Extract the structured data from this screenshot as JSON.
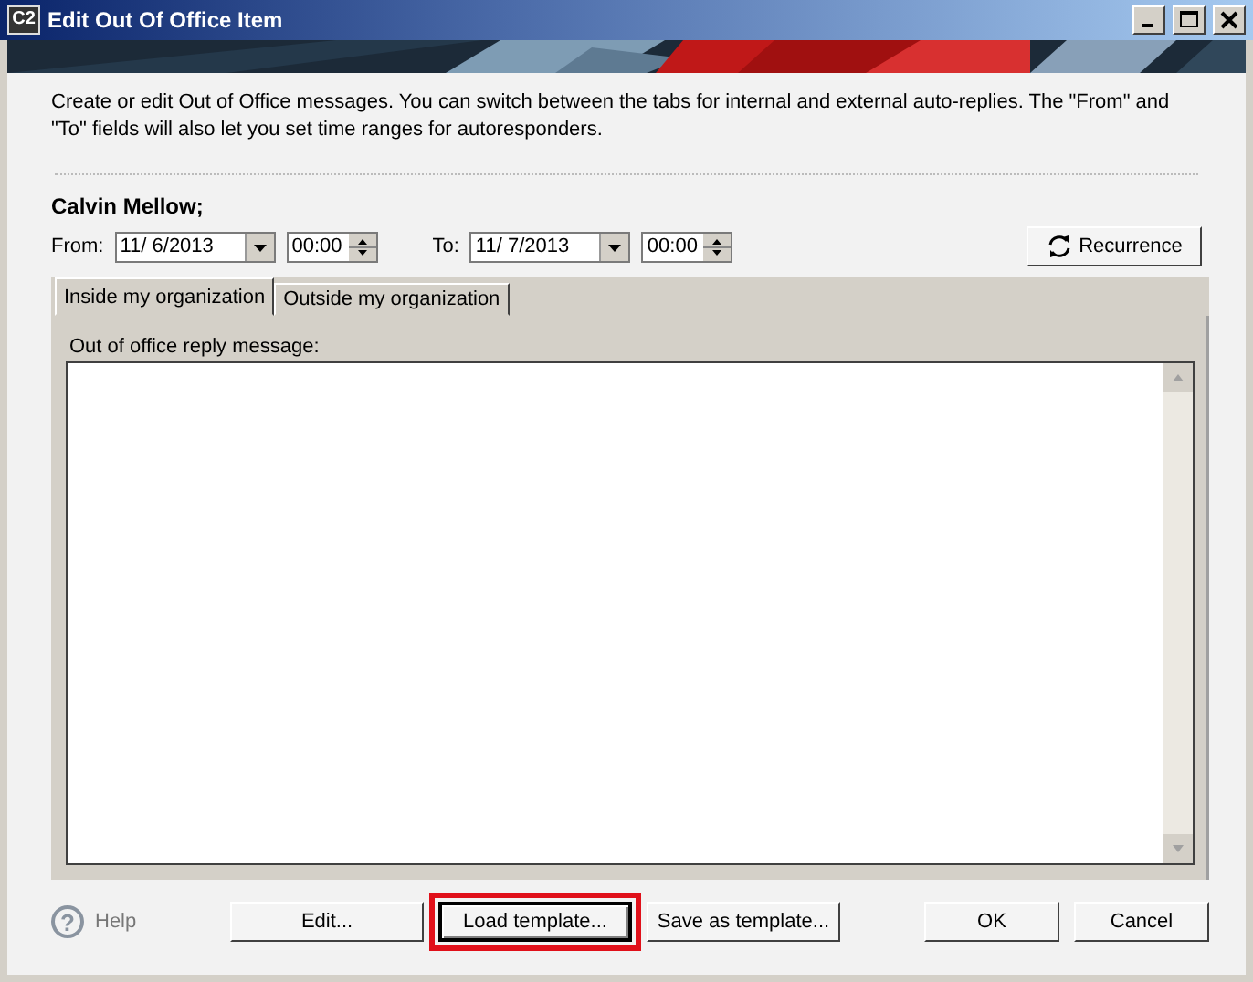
{
  "window": {
    "title": "Edit Out Of Office Item",
    "app_icon": "C2"
  },
  "description": "Create or edit Out of Office messages. You can switch between the tabs for internal and external auto-replies. The \"From\" and \"To\" fields will also let you set time ranges for autoresponders.",
  "user_name": "Calvin Mellow;",
  "from": {
    "label": "From:",
    "date": "11/ 6/2013",
    "time": "00:00"
  },
  "to": {
    "label": "To:",
    "date": "11/ 7/2013",
    "time": "00:00"
  },
  "recurrence_button": "Recurrence",
  "tabs": [
    {
      "label": "Inside my organization",
      "selected": true
    },
    {
      "label": "Outside my organization",
      "selected": false
    }
  ],
  "message": {
    "label": "Out of office reply message:"
  },
  "help": {
    "icon": "?",
    "label": "Help"
  },
  "buttons": [
    {
      "label": "Edit...",
      "kind": "left",
      "highlighted": false
    },
    {
      "label": "Load template...",
      "kind": "left",
      "highlighted": true
    },
    {
      "label": "Save as template...",
      "kind": "left",
      "highlighted": false
    },
    {
      "label": "OK",
      "kind": "right",
      "highlighted": false
    },
    {
      "label": "Cancel",
      "kind": "right",
      "highlighted": false
    }
  ]
}
